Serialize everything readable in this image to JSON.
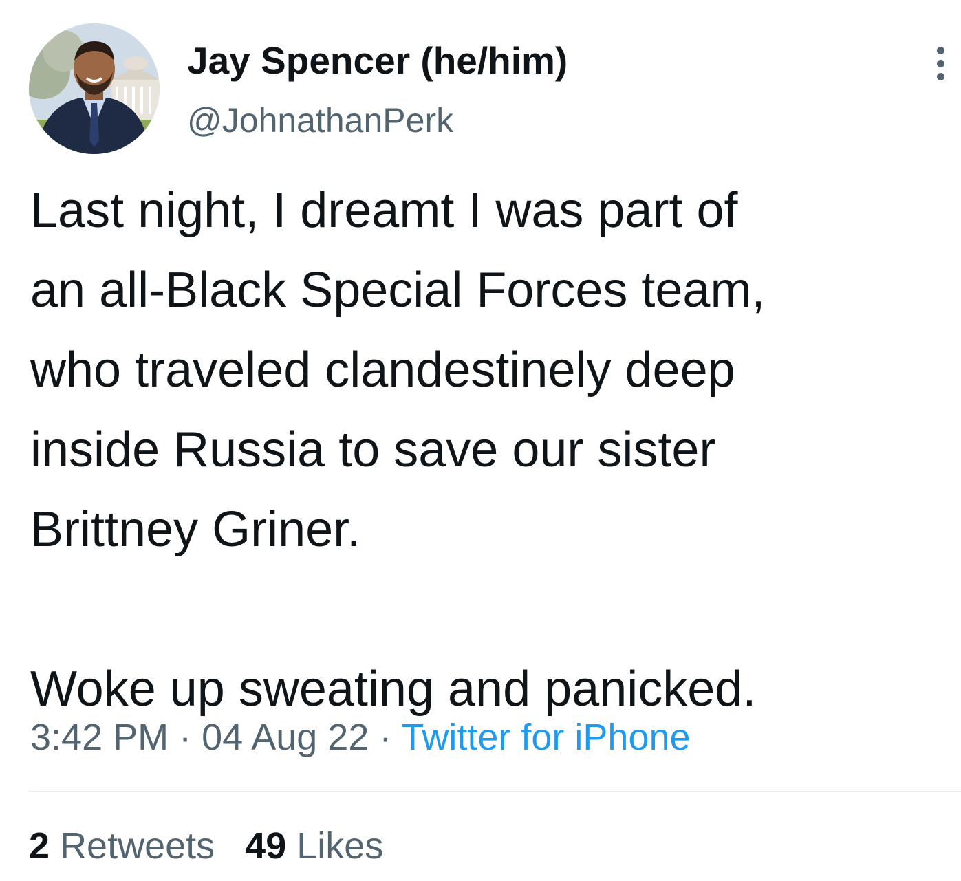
{
  "author": {
    "display_name": "Jay Spencer (he/him)",
    "handle": "@JohnathanPerk"
  },
  "tweet": {
    "text": "Last night, I dreamt I was part of\nan all-Black Special Forces team,\nwho traveled clandestinely deep\ninside Russia to save our sister\nBrittney Griner.\n\nWoke up sweating and panicked."
  },
  "meta": {
    "time": "3:42 PM",
    "separator": " · ",
    "date": "04 Aug 22",
    "source": "Twitter for iPhone"
  },
  "stats": {
    "retweets_count": "2",
    "retweets_label": "Retweets",
    "likes_count": "49",
    "likes_label": "Likes"
  },
  "icons": {
    "more": "more-vertical-icon"
  },
  "colors": {
    "text_primary": "#0f1419",
    "text_secondary": "#536471",
    "link": "#1d9bf0",
    "divider": "#e6ecf0"
  }
}
